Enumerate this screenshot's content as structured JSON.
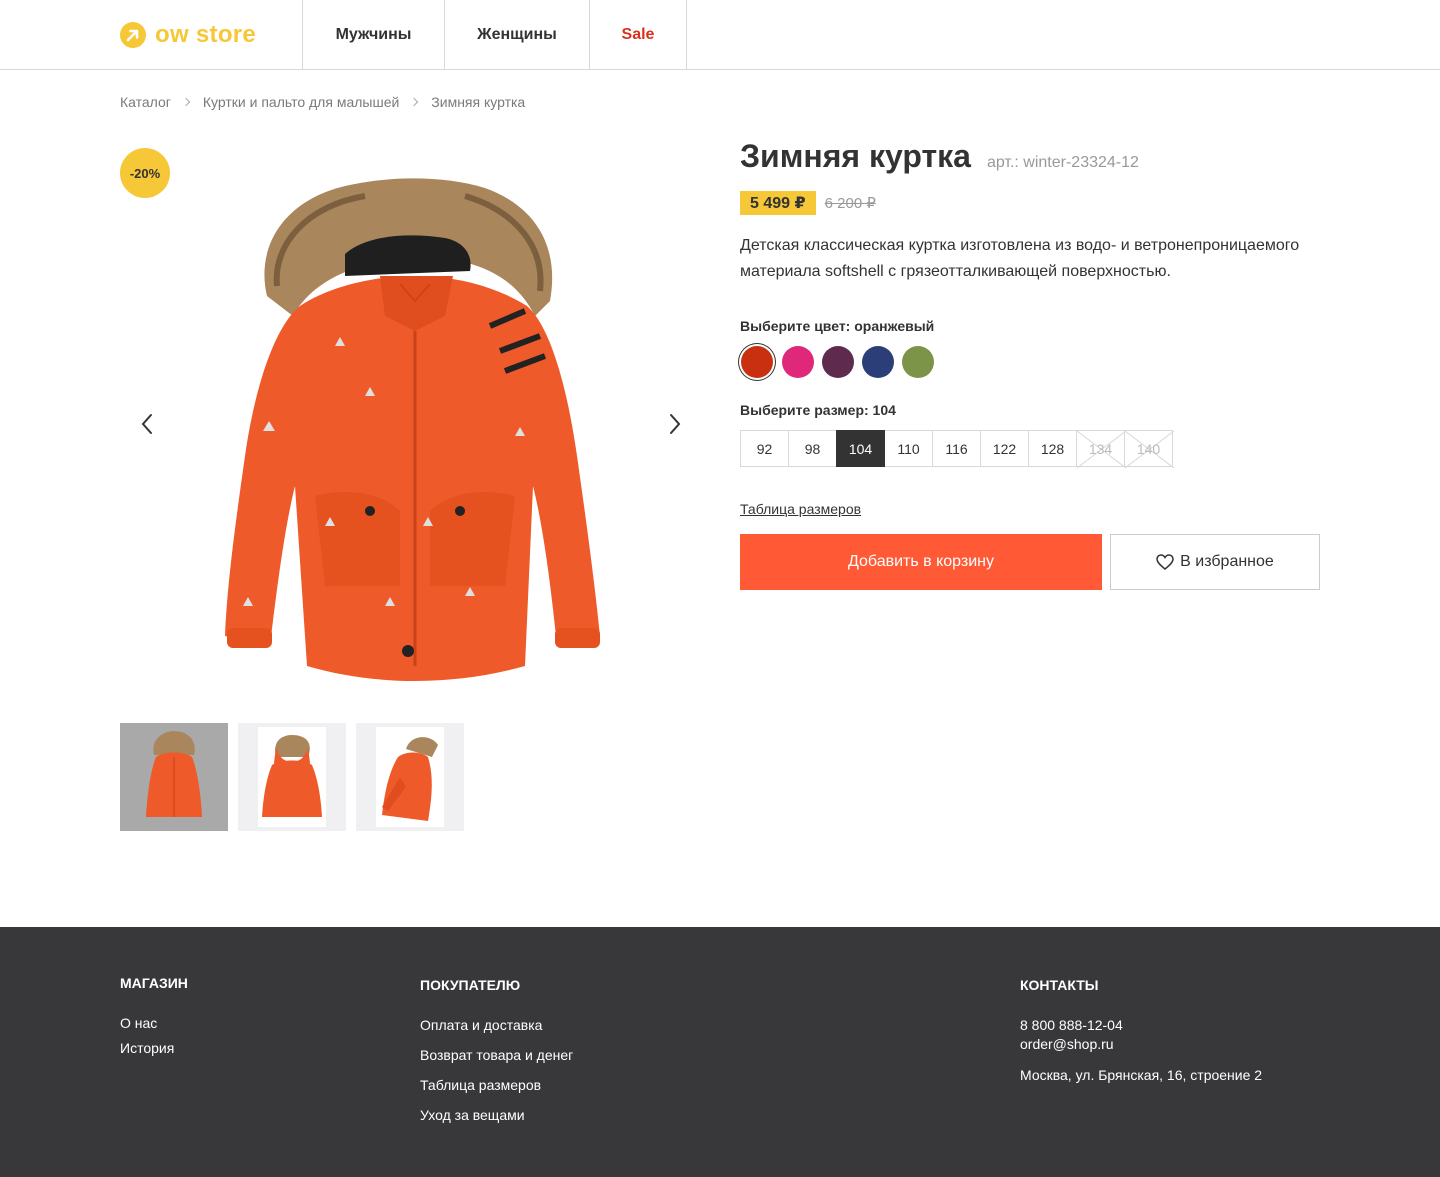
{
  "header": {
    "logo_text": "ow store",
    "nav": [
      {
        "label": "Мужчины"
      },
      {
        "label": "Женщины"
      },
      {
        "label": "Sale"
      }
    ]
  },
  "breadcrumbs": [
    "Каталог",
    "Куртки и пальто для малышей",
    "Зимняя куртка"
  ],
  "gallery": {
    "discount_badge": "-20%",
    "prev_icon": "chevron-left-icon",
    "next_icon": "chevron-right-icon",
    "thumbnails": 3,
    "active_thumbnail": 0
  },
  "product": {
    "title": "Зимняя куртка",
    "sku": "арт.: winter-23324-12",
    "price": "5 499 ₽",
    "old_price": "6 200 ₽",
    "description": "Детская классическая куртка изготовлена из водо- и ветронепроницаемого материала softshell с грязеотталкивающей поверхностью.",
    "color_label": "Выберите цвет: оранжевый",
    "colors": [
      {
        "name": "оранжевый",
        "hex": "#c9300f",
        "selected": true
      },
      {
        "name": "розовый",
        "hex": "#e0287a",
        "selected": false
      },
      {
        "name": "сливовый",
        "hex": "#5e2a4e",
        "selected": false
      },
      {
        "name": "синий",
        "hex": "#2b3e78",
        "selected": false
      },
      {
        "name": "оливковый",
        "hex": "#7c9448",
        "selected": false
      }
    ],
    "size_label": "Выберите размер: 104",
    "sizes": [
      {
        "label": "92",
        "state": "available"
      },
      {
        "label": "98",
        "state": "available"
      },
      {
        "label": "104",
        "state": "selected"
      },
      {
        "label": "110",
        "state": "available"
      },
      {
        "label": "116",
        "state": "available"
      },
      {
        "label": "122",
        "state": "available"
      },
      {
        "label": "128",
        "state": "available"
      },
      {
        "label": "134",
        "state": "disabled"
      },
      {
        "label": "140",
        "state": "disabled"
      }
    ],
    "size_table_link": "Таблица размеров",
    "add_to_cart": "Добавить в корзину",
    "favorite": "В избранное"
  },
  "footer": {
    "shop": {
      "title": "МАГАЗИН",
      "links": [
        "О нас",
        "История"
      ]
    },
    "buyer": {
      "title": "ПОКУПАТЕЛЮ",
      "links": [
        "Оплата и доставка",
        "Возврат товара и денег",
        "Таблица размеров",
        "Уход за вещами"
      ]
    },
    "contacts": {
      "title": "КОНТАКТЫ",
      "phone": "8 800 888-12-04",
      "email": "order@shop.ru",
      "address": "Москва, ул. Брянская, 16, строение 2"
    }
  },
  "colors": {
    "accent_yellow": "#f6c737",
    "cta_orange": "#ff5a35",
    "sale_red": "#d8321e",
    "footer_bg": "#38383a"
  }
}
